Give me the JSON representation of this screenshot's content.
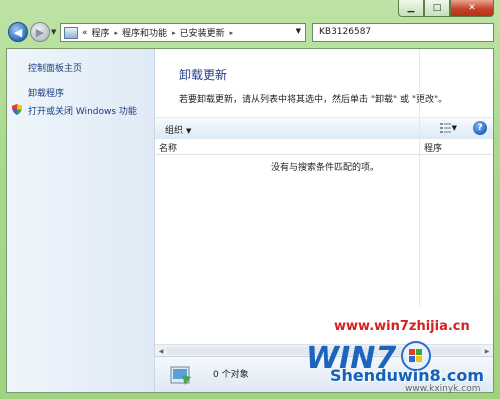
{
  "caption": {
    "minimize": "▁",
    "maximize": "□",
    "close": "✕"
  },
  "address": {
    "chevron": "«",
    "segments": [
      "程序",
      "程序和功能",
      "已安装更新"
    ],
    "separator": "▸"
  },
  "search": {
    "value": "KB3126587"
  },
  "sidebar": {
    "home": "控制面板主页",
    "uninstall_program": "卸载程序",
    "windows_features": "打开或关闭 Windows 功能"
  },
  "main": {
    "title": "卸载更新",
    "instruction": "若要卸载更新，请从列表中将其选中，然后单击 \"卸载\" 或 \"更改\"。",
    "toolbar": {
      "organize": "组织",
      "help": "?"
    },
    "columns": [
      "名称",
      "程序"
    ],
    "empty_message": "没有与搜索条件匹配的项。"
  },
  "status": {
    "count_text": "0 个对象"
  },
  "watermark": {
    "url": "www.win7zhijia.cn",
    "site": "Shenduwin8.com",
    "site2": "www.kxinyk.com"
  },
  "colors": {
    "title_blue": "#1e3a87",
    "link_blue": "#1a3e7a",
    "frame_green": "#a8d98c",
    "watermark_red": "#d42121"
  }
}
